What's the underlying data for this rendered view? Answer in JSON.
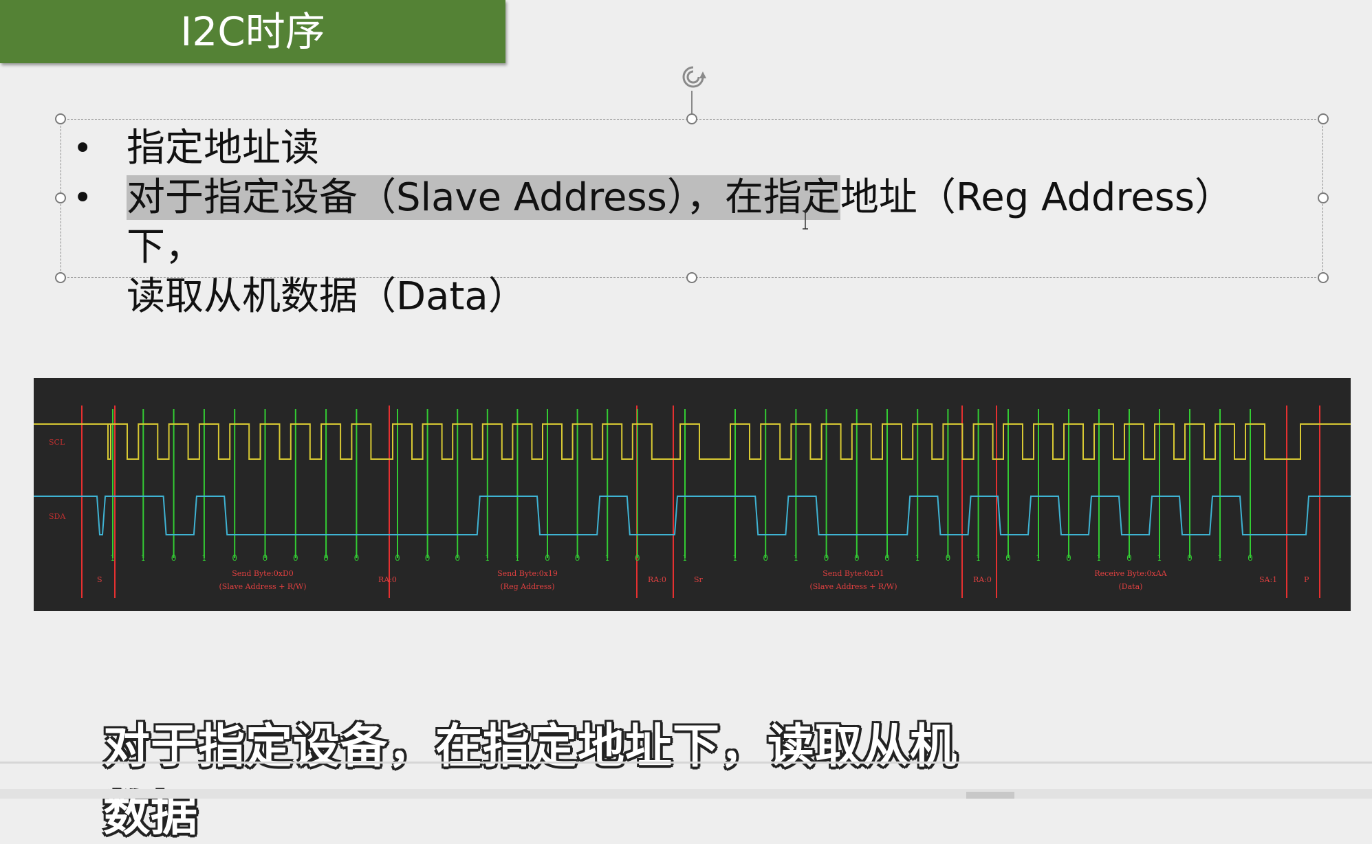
{
  "slide": {
    "title": "I2C时序",
    "bullets": [
      {
        "text": "指定地址读"
      },
      {
        "highlight": "对于指定设备（Slave Address），在指定",
        "rest": "地址（Reg Address）下，",
        "line2": "读取从机数据（Data）"
      }
    ]
  },
  "waveform": {
    "channels": [
      "SCL",
      "SDA"
    ],
    "colors": {
      "scl": "#d8c933",
      "sda": "#3fb3d3",
      "bit_marker": "#33cc33",
      "boundary": "#e53030",
      "annotation": "#e04040",
      "bit_value": "#33cc33"
    },
    "bit_values": [
      "1",
      "1",
      "0",
      "1",
      "0",
      "0",
      "0",
      "0",
      "0",
      "0",
      "0",
      "0",
      "1",
      "1",
      "0",
      "0",
      "1",
      "0",
      "1",
      "1",
      "0",
      "1",
      "0",
      "0",
      "0",
      "1",
      "0",
      "1",
      "0",
      "1",
      "0",
      "1",
      "0",
      "1",
      "0",
      "1",
      "0",
      "1"
    ],
    "labels": {
      "start": "S",
      "send1": [
        "Send Byte:0xD0",
        "(Slave Address + R/W)"
      ],
      "ack1": "RA:0",
      "send2": [
        "Send Byte:0x19",
        "(Reg Address)"
      ],
      "ack2": "RA:0",
      "restart": "Sr",
      "send3": [
        "Send Byte:0xD1",
        "(Slave Address + R/W)"
      ],
      "ack3": "RA:0",
      "recv": [
        "Receive Byte:0xAA",
        "(Data)"
      ],
      "nack": "SA:1",
      "stop": "P"
    }
  },
  "subtitle": "对于指定设备，在指定地址下，读取从机数据"
}
